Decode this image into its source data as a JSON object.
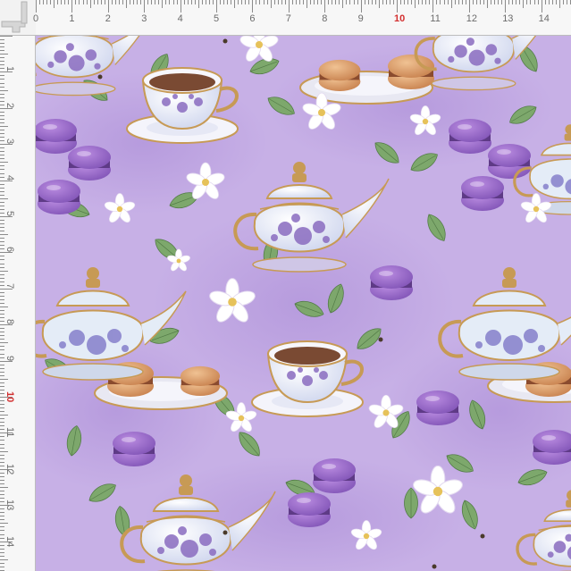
{
  "ruler": {
    "top_labels": [
      "0",
      "1",
      "2",
      "3",
      "4",
      "5",
      "6",
      "7",
      "8",
      "9",
      "10",
      "11",
      "12",
      "13",
      "14"
    ],
    "left_labels": [
      "1",
      "2",
      "3",
      "4",
      "5",
      "6",
      "7",
      "8",
      "9",
      "10",
      "11",
      "12",
      "13",
      "14"
    ],
    "highlight_label": "10"
  },
  "pattern": {
    "background": "#c7b0e6",
    "accent_purple": "#9b6bcc",
    "leaf_green": "#6e9a5c",
    "porcelain": "#eef0fa",
    "gold": "#c79a55",
    "tea": "#7a4a33",
    "macaron_orange": "#d99a66"
  }
}
